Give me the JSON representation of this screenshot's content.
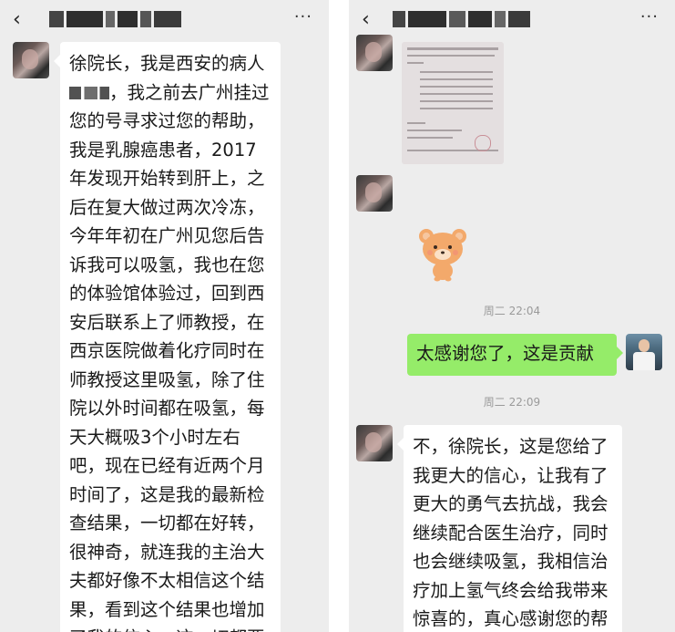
{
  "left": {
    "header": {
      "back": "‹",
      "more": "···"
    },
    "message": {
      "lines": [
        "徐院长，我是西安的病人",
        "，我之前去广州挂过",
        "您的号寻求过您的帮助，",
        "我是乳腺癌患者，2017",
        "年发现开始转到肝上，之",
        "后在复大做过两次冷冻，",
        "今年年初在广州见您后告",
        "诉我可以吸氢，我也在您",
        "的体验馆体验过，回到西",
        "安后联系上了师教授，在",
        "西京医院做着化疗同时在",
        "师教授这里吸氢，除了住",
        "院以外时间都在吸氢，每",
        "天大概吸3个小时左右",
        "吧，现在已经有近两个月",
        "时间了，这是我的最新检",
        "查结果，一切都在好转，",
        "很神奇，就连我的主治大",
        "夫都好像不太相信这个结",
        "果，看到这个结果也增加",
        "了我的信心，这一切都要"
      ]
    }
  },
  "right": {
    "header": {
      "back": "‹",
      "more": "···"
    },
    "timestamps": [
      "周二 22:04",
      "周二 22:09"
    ],
    "sent_message": "太感谢您了，这是贡献",
    "reply": {
      "lines": [
        "不，徐院长，这是您给了",
        "我更大的信心，让我有了",
        "更大的勇气去抗战，我会",
        "继续配合医生治疗，同时",
        "也会继续吸氢，我相信治",
        "疗加上氢气终会给我带来",
        "惊喜的，真心感谢您的帮"
      ]
    }
  },
  "colors": {
    "chat_bg": "#ededed",
    "bubble_white": "#ffffff",
    "bubble_green": "#95ec69",
    "timestamp": "#9a9a9a"
  },
  "icons": [
    "back-chevron-icon",
    "more-dots-icon",
    "bear-sticker"
  ]
}
